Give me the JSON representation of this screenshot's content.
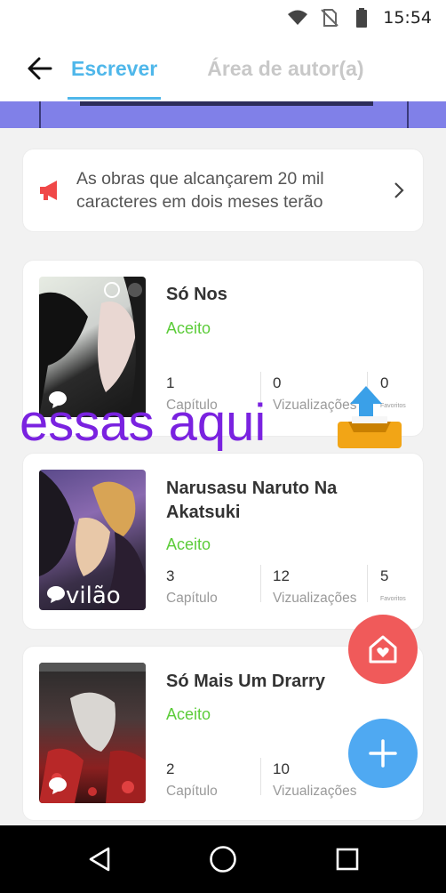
{
  "status_bar": {
    "time": "15:54",
    "icons": [
      "wifi-icon",
      "no-sim-icon",
      "battery-icon"
    ]
  },
  "header": {
    "back_icon": "arrow-left-icon",
    "tabs": [
      {
        "label": "Escrever",
        "active": true
      },
      {
        "label": "Área de autor(a)",
        "active": false
      }
    ]
  },
  "notice": {
    "icon": "megaphone-icon",
    "text": "As obras que alcançarem 20 mil caracteres em dois meses terão",
    "chevron": "chevron-right-icon"
  },
  "works": [
    {
      "title": "Só Nos",
      "status": "Aceito",
      "stats": [
        {
          "value": "1",
          "label": "Capítulo"
        },
        {
          "value": "0",
          "label": "Vizualizações"
        },
        {
          "value": "0",
          "label": "Favoritos"
        }
      ]
    },
    {
      "title": "Narusasu Naruto Na Akatsuki",
      "status": "Aceito",
      "cover_text": "vilão",
      "stats": [
        {
          "value": "3",
          "label": "Capítulo"
        },
        {
          "value": "12",
          "label": "Vizualizações"
        },
        {
          "value": "5",
          "label": "Favoritos"
        }
      ]
    },
    {
      "title": "Só Mais Um Drarry",
      "status": "Aceito",
      "stats": [
        {
          "value": "2",
          "label": "Capítulo"
        },
        {
          "value": "10",
          "label": "Vizualizações"
        },
        {
          "value": "",
          "label": ""
        }
      ]
    }
  ],
  "annotation": {
    "text": "essas aqui"
  },
  "fabs": {
    "home_icon": "house-heart-icon",
    "add_icon": "plus-icon"
  },
  "nav": {
    "icons": [
      "back-triangle-icon",
      "home-circle-icon",
      "recents-square-icon"
    ]
  },
  "colors": {
    "accent": "#4fb7ea",
    "accepted": "#5ccc3a",
    "annotation": "#7a22e0",
    "fab_home": "#f05a5a",
    "fab_add": "#4fa9f2"
  }
}
